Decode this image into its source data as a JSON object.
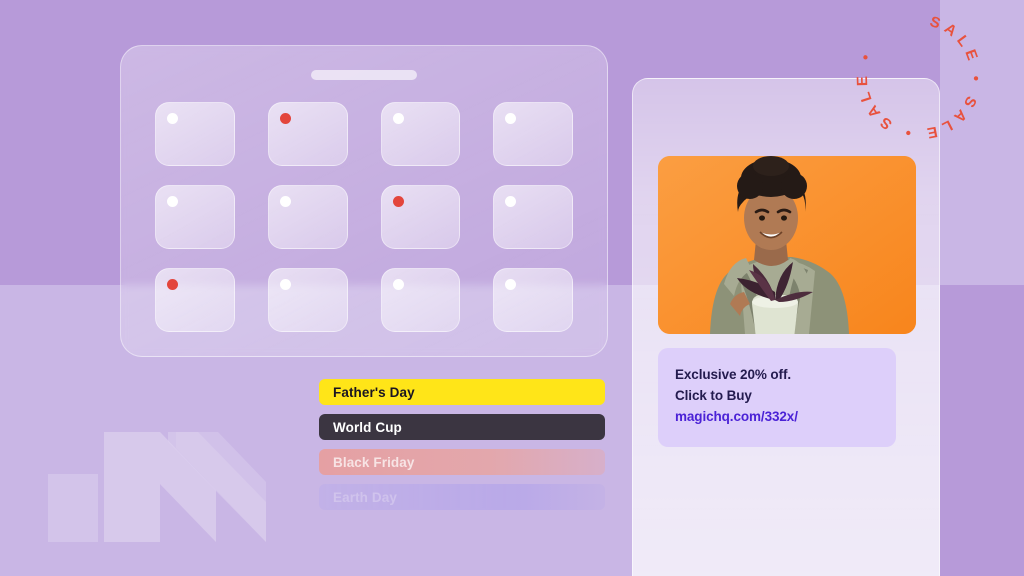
{
  "background": {
    "base_color": "#b79ad9",
    "light_color": "#c9b6e5"
  },
  "watermark": {
    "name": "brand-logo-watermark",
    "color": "#ffffff"
  },
  "grid_panel": {
    "handle_label": "",
    "cards": [
      {
        "id": "card-1",
        "dot": "normal"
      },
      {
        "id": "card-2",
        "dot": "alert"
      },
      {
        "id": "card-3",
        "dot": "normal"
      },
      {
        "id": "card-4",
        "dot": "normal"
      },
      {
        "id": "card-5",
        "dot": "normal"
      },
      {
        "id": "card-6",
        "dot": "normal"
      },
      {
        "id": "card-7",
        "dot": "alert"
      },
      {
        "id": "card-8",
        "dot": "normal"
      },
      {
        "id": "card-9",
        "dot": "alert"
      },
      {
        "id": "card-10",
        "dot": "normal"
      },
      {
        "id": "card-11",
        "dot": "normal"
      },
      {
        "id": "card-12",
        "dot": "normal"
      }
    ],
    "dot_colors": {
      "normal": "#ffffff",
      "alert": "#e3453c"
    }
  },
  "campaigns": [
    {
      "label": "Father's Day",
      "style": "c-fathers",
      "bg": "#ffe518",
      "text": "#1a1522"
    },
    {
      "label": "World Cup",
      "style": "c-worldcup",
      "bg": "#3b3541",
      "text": "#ffffff"
    },
    {
      "label": "Black Friday",
      "style": "c-blackfriday",
      "bg": "#e5a0a3",
      "text": "#ffffff"
    },
    {
      "label": "Earth Day",
      "style": "c-earthday",
      "bg": "#968cf0",
      "text": "#ffffff"
    }
  ],
  "ad_preview": {
    "image_alt": "smiling-woman-holding-potted-plant",
    "image_bg": "#fa8f2e",
    "copy": {
      "line1": "Exclusive 20% off.",
      "line2": "Click to Buy",
      "link": "magichq.com/332x/",
      "link_color": "#4b22d6",
      "card_bg": "#ddcffa"
    }
  },
  "sale_badge": {
    "text": "SALE • SALE • SALE • ",
    "color": "#e8523e"
  }
}
